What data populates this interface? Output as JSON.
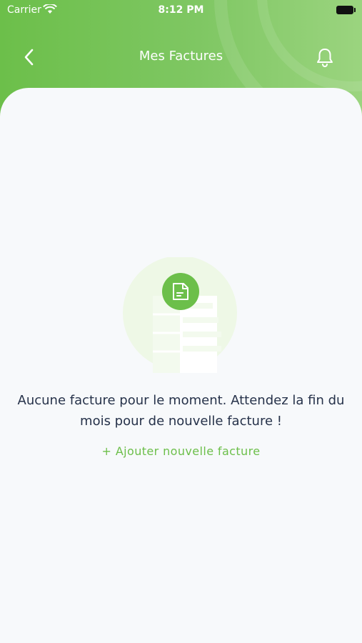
{
  "status_bar": {
    "carrier": "Carrier",
    "time": "8:12 PM"
  },
  "header": {
    "title": "Mes Factures",
    "back_icon": "chevron-left-icon",
    "bell_icon": "bell-icon"
  },
  "empty_state": {
    "illustration_icon": "document-icon",
    "message": "Aucune facture pour le moment. Attendez la fin du mois pour de nouvelle facture !",
    "add_link": "+ Ajouter nouvelle facture"
  },
  "colors": {
    "accent": "#6cbf4a",
    "text": "#26324a",
    "background": "#f7f9fb"
  }
}
